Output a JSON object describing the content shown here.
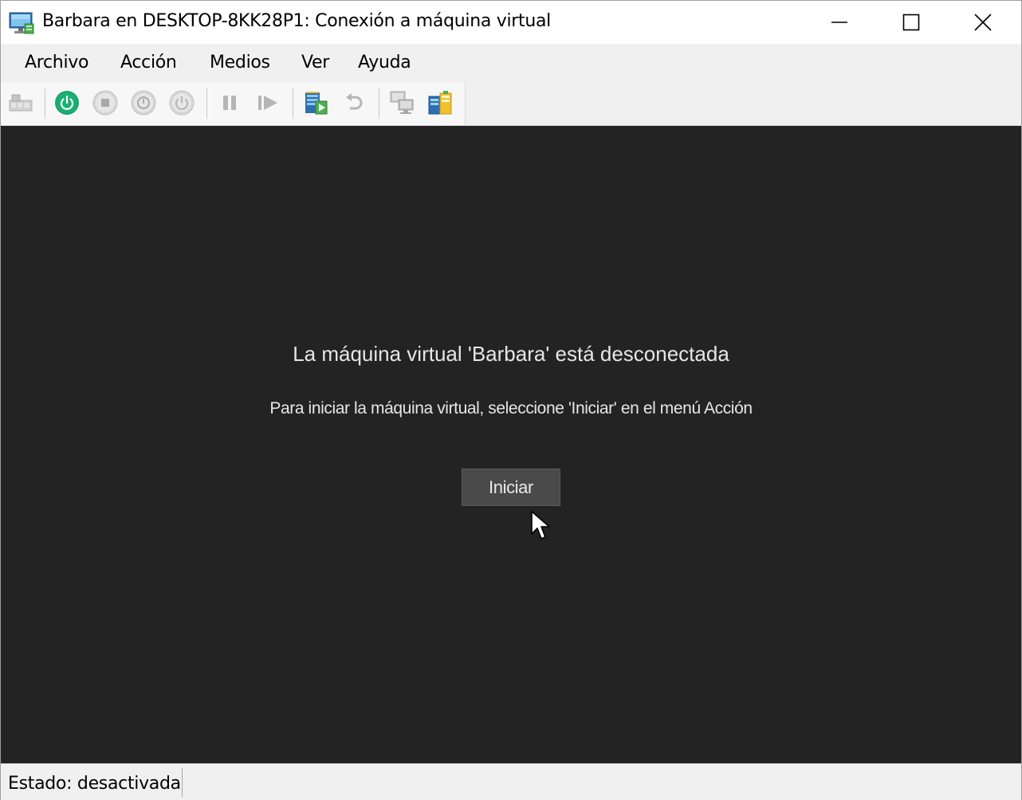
{
  "window": {
    "title": "Barbara en DESKTOP-8KK28P1: Conexión a máquina virtual",
    "icon": "vm-connection-icon",
    "controls": [
      "minimize-icon",
      "maximize-icon",
      "close-icon"
    ]
  },
  "menu": {
    "items": [
      {
        "label": "Archivo"
      },
      {
        "label": "Acción"
      },
      {
        "label": "Medios"
      },
      {
        "label": "Ver"
      },
      {
        "label": "Ayuda"
      }
    ]
  },
  "toolbar": {
    "buttons": [
      {
        "icon": "ctrl-alt-del-icon",
        "enabled": false
      },
      {
        "icon": "start-icon",
        "enabled": true
      },
      {
        "icon": "turn-off-icon",
        "enabled": false
      },
      {
        "icon": "shut-down-icon",
        "enabled": false
      },
      {
        "icon": "save-icon",
        "enabled": false
      },
      {
        "icon": "pause-icon",
        "enabled": false
      },
      {
        "icon": "resume-icon",
        "enabled": false
      },
      {
        "icon": "checkpoint-icon",
        "enabled": true
      },
      {
        "icon": "revert-icon",
        "enabled": false
      },
      {
        "icon": "enhanced-session-icon",
        "enabled": false
      },
      {
        "icon": "share-icon",
        "enabled": true
      }
    ],
    "accent_color": "#1aa56e"
  },
  "vm": {
    "message_title": "La máquina virtual 'Barbara' está desconectada",
    "message_subtitle": "Para iniciar la máquina virtual, seleccione 'Iniciar' en el menú Acción",
    "start_button_label": "Iniciar",
    "background_color": "#232323"
  },
  "status": {
    "text": "Estado: desactivada"
  }
}
